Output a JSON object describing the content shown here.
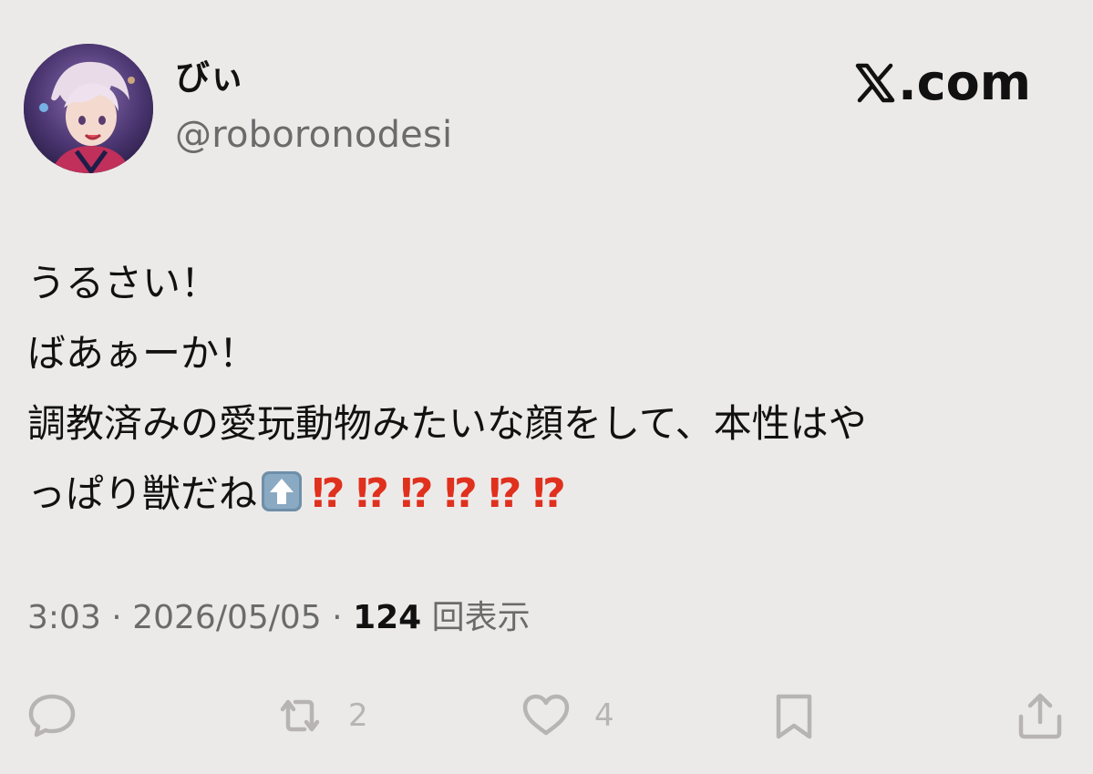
{
  "author": {
    "display_name": "びぃ",
    "handle": "@roboronodesi"
  },
  "brand": {
    "label": ".com",
    "logo_icon": "x-logo-icon"
  },
  "tweet": {
    "lines": [
      "うるさい！",
      "ばあぁーか！",
      "調教済みの愛玩動物みたいな顔をして、本性はや",
      "っぱり獣だね"
    ],
    "emoji_up": "up-arrow-emoji",
    "interrobangs": [
      "⁉",
      "⁉",
      "⁉",
      "⁉",
      "⁉",
      "⁉"
    ]
  },
  "meta": {
    "time": "3:03",
    "separator": "·",
    "date": "2026/05/05",
    "views_count": "124",
    "views_label": "回表示"
  },
  "actions": {
    "reply": {
      "icon": "reply-icon",
      "count": ""
    },
    "retweet": {
      "icon": "retweet-icon",
      "count": "2"
    },
    "like": {
      "icon": "heart-icon",
      "count": "4"
    },
    "bookmark": {
      "icon": "bookmark-icon",
      "count": ""
    },
    "share": {
      "icon": "share-icon",
      "count": ""
    }
  },
  "colors": {
    "background": "#ECEAE9",
    "text": "#111111",
    "muted": "#6b6b6b",
    "icon": "#b7b4b3",
    "interrobang": "#e0301e"
  }
}
